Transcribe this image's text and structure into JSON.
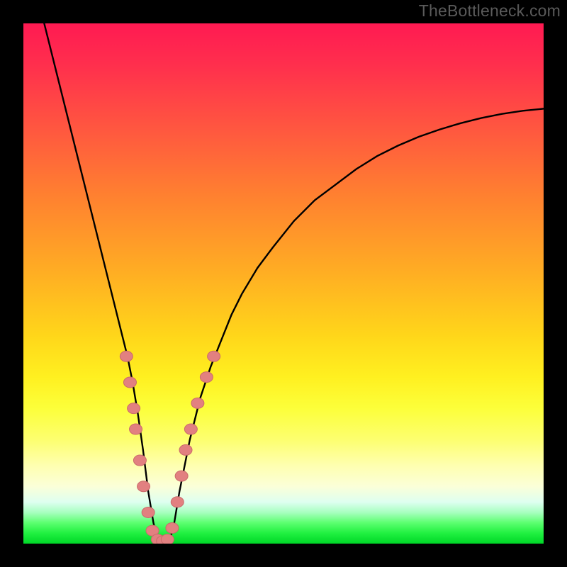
{
  "watermark": "TheBottleneck.com",
  "colors": {
    "background": "#000000",
    "curve": "#000000",
    "marker_fill": "#e28080",
    "marker_stroke": "#c96a6a",
    "gradient_top": "#ff1a52",
    "gradient_bottom": "#00d828"
  },
  "chart_data": {
    "type": "line",
    "title": "",
    "xlabel": "",
    "ylabel": "",
    "xlim": [
      0,
      100
    ],
    "ylim": [
      0,
      100
    ],
    "curve": {
      "name": "bottleneck-curve",
      "x": [
        4,
        6,
        8,
        10,
        12,
        14,
        16,
        18,
        19,
        20,
        21,
        22,
        23,
        24,
        25,
        26,
        27,
        28,
        29,
        30,
        32,
        34,
        36,
        38,
        40,
        42,
        45,
        48,
        52,
        56,
        60,
        64,
        68,
        72,
        76,
        80,
        84,
        88,
        92,
        96,
        100
      ],
      "y": [
        100,
        92,
        84,
        76,
        68,
        60,
        52,
        44,
        40,
        36,
        31,
        25,
        18,
        10,
        4,
        0,
        0,
        0,
        4,
        10,
        20,
        28,
        34,
        39,
        44,
        48,
        53,
        57,
        62,
        66,
        69,
        72,
        74.5,
        76.5,
        78.2,
        79.6,
        80.8,
        81.8,
        82.6,
        83.2,
        83.6
      ]
    },
    "markers": {
      "name": "highlight-points",
      "points": [
        {
          "x": 19.8,
          "y": 36
        },
        {
          "x": 20.5,
          "y": 31
        },
        {
          "x": 21.2,
          "y": 26
        },
        {
          "x": 21.6,
          "y": 22
        },
        {
          "x": 22.4,
          "y": 16
        },
        {
          "x": 23.1,
          "y": 11
        },
        {
          "x": 24.0,
          "y": 6
        },
        {
          "x": 24.8,
          "y": 2.5
        },
        {
          "x": 25.8,
          "y": 0.8
        },
        {
          "x": 26.8,
          "y": 0.5
        },
        {
          "x": 27.7,
          "y": 0.8
        },
        {
          "x": 28.6,
          "y": 3
        },
        {
          "x": 29.6,
          "y": 8
        },
        {
          "x": 30.4,
          "y": 13
        },
        {
          "x": 31.2,
          "y": 18
        },
        {
          "x": 32.2,
          "y": 22
        },
        {
          "x": 33.5,
          "y": 27
        },
        {
          "x": 35.2,
          "y": 32
        },
        {
          "x": 36.6,
          "y": 36
        }
      ]
    }
  }
}
